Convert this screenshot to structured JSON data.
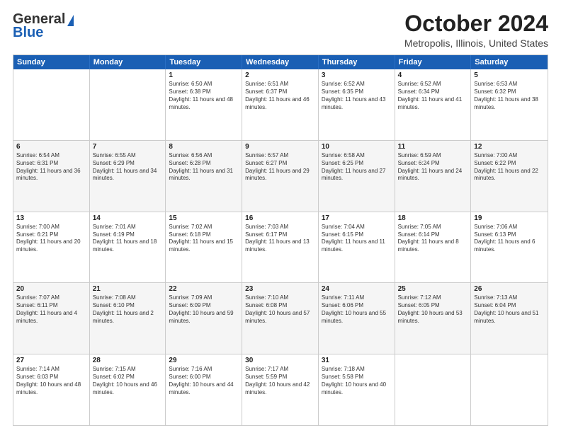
{
  "logo": {
    "line1": "General",
    "line2": "Blue"
  },
  "title": "October 2024",
  "subtitle": "Metropolis, Illinois, United States",
  "days": [
    "Sunday",
    "Monday",
    "Tuesday",
    "Wednesday",
    "Thursday",
    "Friday",
    "Saturday"
  ],
  "rows": [
    [
      {
        "num": "",
        "text": ""
      },
      {
        "num": "",
        "text": ""
      },
      {
        "num": "1",
        "text": "Sunrise: 6:50 AM\nSunset: 6:38 PM\nDaylight: 11 hours and 48 minutes."
      },
      {
        "num": "2",
        "text": "Sunrise: 6:51 AM\nSunset: 6:37 PM\nDaylight: 11 hours and 46 minutes."
      },
      {
        "num": "3",
        "text": "Sunrise: 6:52 AM\nSunset: 6:35 PM\nDaylight: 11 hours and 43 minutes."
      },
      {
        "num": "4",
        "text": "Sunrise: 6:52 AM\nSunset: 6:34 PM\nDaylight: 11 hours and 41 minutes."
      },
      {
        "num": "5",
        "text": "Sunrise: 6:53 AM\nSunset: 6:32 PM\nDaylight: 11 hours and 38 minutes."
      }
    ],
    [
      {
        "num": "6",
        "text": "Sunrise: 6:54 AM\nSunset: 6:31 PM\nDaylight: 11 hours and 36 minutes."
      },
      {
        "num": "7",
        "text": "Sunrise: 6:55 AM\nSunset: 6:29 PM\nDaylight: 11 hours and 34 minutes."
      },
      {
        "num": "8",
        "text": "Sunrise: 6:56 AM\nSunset: 6:28 PM\nDaylight: 11 hours and 31 minutes."
      },
      {
        "num": "9",
        "text": "Sunrise: 6:57 AM\nSunset: 6:27 PM\nDaylight: 11 hours and 29 minutes."
      },
      {
        "num": "10",
        "text": "Sunrise: 6:58 AM\nSunset: 6:25 PM\nDaylight: 11 hours and 27 minutes."
      },
      {
        "num": "11",
        "text": "Sunrise: 6:59 AM\nSunset: 6:24 PM\nDaylight: 11 hours and 24 minutes."
      },
      {
        "num": "12",
        "text": "Sunrise: 7:00 AM\nSunset: 6:22 PM\nDaylight: 11 hours and 22 minutes."
      }
    ],
    [
      {
        "num": "13",
        "text": "Sunrise: 7:00 AM\nSunset: 6:21 PM\nDaylight: 11 hours and 20 minutes."
      },
      {
        "num": "14",
        "text": "Sunrise: 7:01 AM\nSunset: 6:19 PM\nDaylight: 11 hours and 18 minutes."
      },
      {
        "num": "15",
        "text": "Sunrise: 7:02 AM\nSunset: 6:18 PM\nDaylight: 11 hours and 15 minutes."
      },
      {
        "num": "16",
        "text": "Sunrise: 7:03 AM\nSunset: 6:17 PM\nDaylight: 11 hours and 13 minutes."
      },
      {
        "num": "17",
        "text": "Sunrise: 7:04 AM\nSunset: 6:15 PM\nDaylight: 11 hours and 11 minutes."
      },
      {
        "num": "18",
        "text": "Sunrise: 7:05 AM\nSunset: 6:14 PM\nDaylight: 11 hours and 8 minutes."
      },
      {
        "num": "19",
        "text": "Sunrise: 7:06 AM\nSunset: 6:13 PM\nDaylight: 11 hours and 6 minutes."
      }
    ],
    [
      {
        "num": "20",
        "text": "Sunrise: 7:07 AM\nSunset: 6:11 PM\nDaylight: 11 hours and 4 minutes."
      },
      {
        "num": "21",
        "text": "Sunrise: 7:08 AM\nSunset: 6:10 PM\nDaylight: 11 hours and 2 minutes."
      },
      {
        "num": "22",
        "text": "Sunrise: 7:09 AM\nSunset: 6:09 PM\nDaylight: 10 hours and 59 minutes."
      },
      {
        "num": "23",
        "text": "Sunrise: 7:10 AM\nSunset: 6:08 PM\nDaylight: 10 hours and 57 minutes."
      },
      {
        "num": "24",
        "text": "Sunrise: 7:11 AM\nSunset: 6:06 PM\nDaylight: 10 hours and 55 minutes."
      },
      {
        "num": "25",
        "text": "Sunrise: 7:12 AM\nSunset: 6:05 PM\nDaylight: 10 hours and 53 minutes."
      },
      {
        "num": "26",
        "text": "Sunrise: 7:13 AM\nSunset: 6:04 PM\nDaylight: 10 hours and 51 minutes."
      }
    ],
    [
      {
        "num": "27",
        "text": "Sunrise: 7:14 AM\nSunset: 6:03 PM\nDaylight: 10 hours and 48 minutes."
      },
      {
        "num": "28",
        "text": "Sunrise: 7:15 AM\nSunset: 6:02 PM\nDaylight: 10 hours and 46 minutes."
      },
      {
        "num": "29",
        "text": "Sunrise: 7:16 AM\nSunset: 6:00 PM\nDaylight: 10 hours and 44 minutes."
      },
      {
        "num": "30",
        "text": "Sunrise: 7:17 AM\nSunset: 5:59 PM\nDaylight: 10 hours and 42 minutes."
      },
      {
        "num": "31",
        "text": "Sunrise: 7:18 AM\nSunset: 5:58 PM\nDaylight: 10 hours and 40 minutes."
      },
      {
        "num": "",
        "text": ""
      },
      {
        "num": "",
        "text": ""
      }
    ]
  ]
}
